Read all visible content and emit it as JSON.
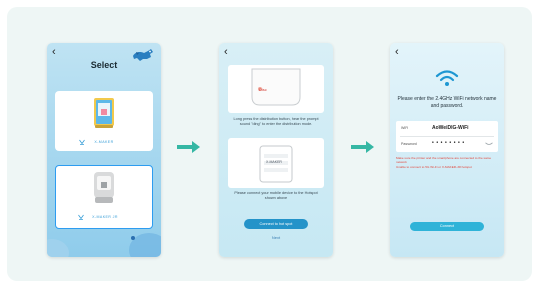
{
  "phone1": {
    "back": "‹",
    "title": "Select",
    "printers": [
      {
        "name": "X-MAKER"
      },
      {
        "name": "X-MAKER JR"
      }
    ]
  },
  "phone2": {
    "back": "‹",
    "illus_label": "Disc",
    "caption1": "Long press the distribution button, hear the prompt sound \"ding\" to enter the distribution mode.",
    "illus2_label": "X-MAKER",
    "caption2": "Please connect your mobile device to the Hotspot shown above",
    "connect_button": "Connect to hot spot",
    "next": "Next"
  },
  "phone3": {
    "back": "‹",
    "title": "Please enter the 2.4GHz WiFi network name and password.",
    "wifi_label": "WiFi",
    "wifi_value": "AoWeiDIG-WiFi",
    "password_label": "Password",
    "password_value": "• • • • • • • •",
    "warning1": "Make sure the printer and the smartphone are connected to the same network",
    "warning2": "Unable to connect to 5G Wi-Fi or X-MAKER-JR hotspot",
    "connect_button": "Connect"
  },
  "colors": {
    "accent": "#2493c9",
    "arrow": "#35b7a4",
    "warning": "#e2453a"
  }
}
